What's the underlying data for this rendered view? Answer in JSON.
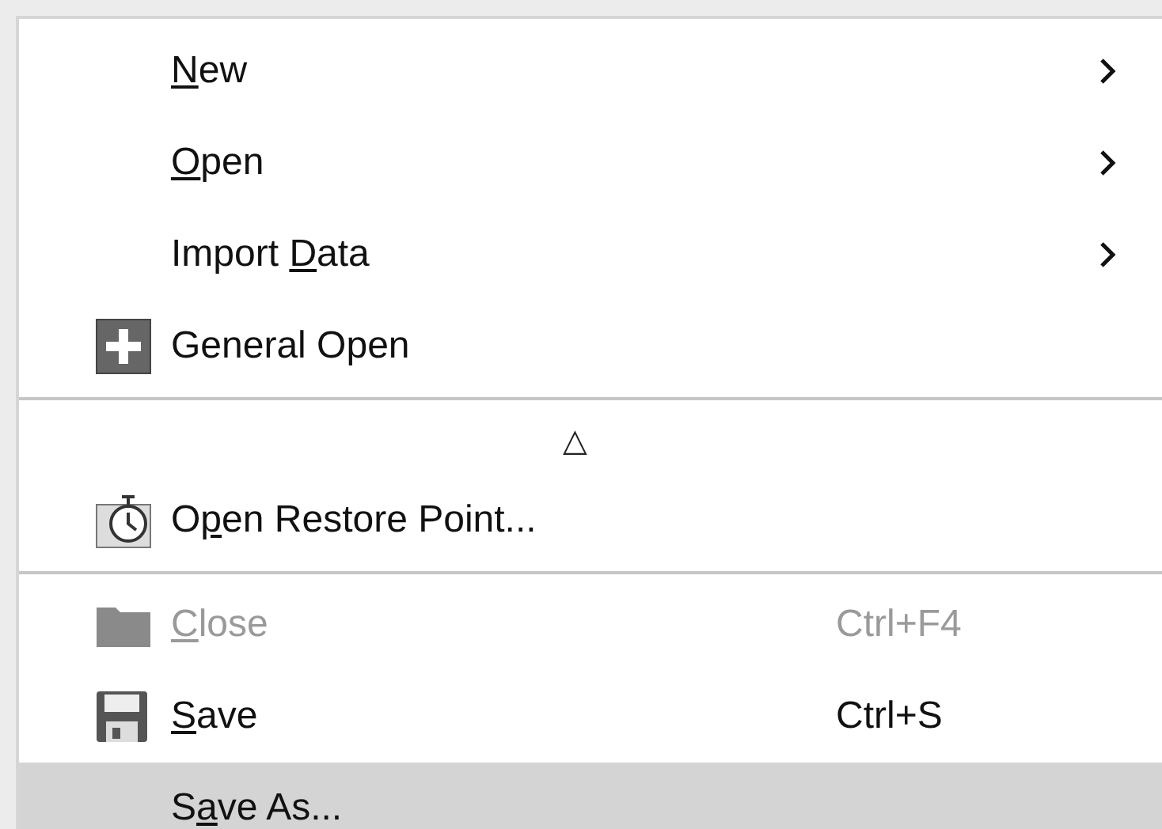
{
  "menu": {
    "items": [
      {
        "kind": "item",
        "label": [
          {
            "text": "N",
            "underline": true
          },
          {
            "text": "ew",
            "underline": false
          }
        ],
        "submenu": true,
        "disabled": false,
        "selected": false
      },
      {
        "kind": "item",
        "label": [
          {
            "text": "O",
            "underline": true
          },
          {
            "text": "pen",
            "underline": false
          }
        ],
        "submenu": true,
        "disabled": false,
        "selected": false
      },
      {
        "kind": "item",
        "label": [
          {
            "text": "Import ",
            "underline": false
          },
          {
            "text": "D",
            "underline": true
          },
          {
            "text": "ata",
            "underline": false
          }
        ],
        "submenu": true,
        "disabled": false,
        "selected": false
      },
      {
        "kind": "item",
        "label": [
          {
            "text": "General Open",
            "underline": false
          }
        ],
        "submenu": false,
        "disabled": false,
        "selected": false
      },
      {
        "kind": "separator"
      },
      {
        "kind": "scroll",
        "label": "△"
      },
      {
        "kind": "item",
        "label": [
          {
            "text": "O",
            "underline": false
          },
          {
            "text": "p",
            "underline": true
          },
          {
            "text": "en Restore Point...",
            "underline": false
          }
        ],
        "submenu": false,
        "disabled": false,
        "selected": false
      },
      {
        "kind": "separator"
      },
      {
        "kind": "item",
        "label": [
          {
            "text": "C",
            "underline": true
          },
          {
            "text": "lose",
            "underline": false
          }
        ],
        "shortcut": "Ctrl+F4",
        "submenu": false,
        "disabled": true,
        "selected": false
      },
      {
        "kind": "item",
        "label": [
          {
            "text": "S",
            "underline": true
          },
          {
            "text": "ave",
            "underline": false
          }
        ],
        "shortcut": "Ctrl+S",
        "submenu": false,
        "disabled": false,
        "selected": false
      },
      {
        "kind": "item",
        "label": [
          {
            "text": "S",
            "underline": false
          },
          {
            "text": "a",
            "underline": true
          },
          {
            "text": "ve As...",
            "underline": false
          }
        ],
        "submenu": false,
        "disabled": false,
        "selected": true
      }
    ]
  }
}
